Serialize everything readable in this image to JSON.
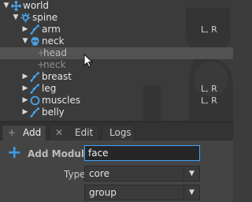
{
  "tree": {
    "items": [
      {
        "label": "world",
        "arrow": "▼",
        "icon": "world-icon",
        "extra": ""
      },
      {
        "label": "spine",
        "arrow": "▼",
        "icon": "spine-icon",
        "extra": ""
      },
      {
        "label": "arm",
        "arrow": "▶",
        "icon": "limb-icon",
        "extra": "L, R"
      },
      {
        "label": "neck",
        "arrow": "▼",
        "icon": "skull-icon",
        "extra": ""
      },
      {
        "label": "head",
        "arrow": "",
        "icon": "plus-icon",
        "extra": ""
      },
      {
        "label": "neck",
        "arrow": "",
        "icon": "plus-icon",
        "extra": ""
      },
      {
        "label": "breast",
        "arrow": "▶",
        "icon": "limb-icon",
        "extra": ""
      },
      {
        "label": "leg",
        "arrow": "▶",
        "icon": "limb-icon",
        "extra": "L, R"
      },
      {
        "label": "muscles",
        "arrow": "▶",
        "icon": "circle-icon",
        "extra": "L, R"
      },
      {
        "label": "belly",
        "arrow": "▶",
        "icon": "limb-icon",
        "extra": ""
      }
    ]
  },
  "tabs": [
    {
      "label": "Add",
      "icon": "+"
    },
    {
      "label": "Edit",
      "icon": "✕"
    },
    {
      "label": "Logs",
      "icon": ""
    }
  ],
  "panel": {
    "add_label": "Add Module",
    "add_icon": "+",
    "module_value": "face",
    "type_label": "Type",
    "type_value": "core",
    "group_value": "group"
  },
  "colors": {
    "accent": "#3d9be9",
    "tree_icon": "#4aa3e8"
  }
}
